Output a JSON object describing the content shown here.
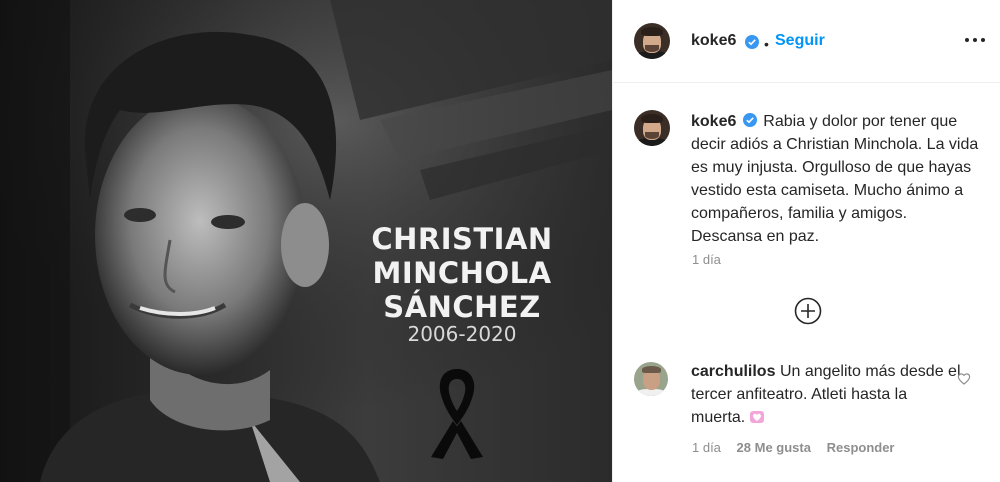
{
  "post": {
    "photo": {
      "name_line1": "CHRISTIAN",
      "name_line2": "MINCHOLA",
      "name_line3": "SÁNCHEZ",
      "years": "2006-2020",
      "ribbon_icon": "black-mourning-ribbon-icon"
    },
    "header": {
      "username": "koke6",
      "verified_icon": "verified-badge-icon",
      "separator": "•",
      "follow_label": "Seguir",
      "more_icon": "more-options-icon"
    },
    "caption": {
      "username": "koke6",
      "text": "Rabia y dolor por tener que decir adiós a Christian Minchola. La vida es muy injusta. Orgulloso de que hayas vestido esta camiseta. Mucho ánimo a compañeros, familia y amigos. Descansa en paz.",
      "time": "1 día"
    },
    "load_more_icon": "plus-circle-icon",
    "comments": [
      {
        "username": "carchulilos",
        "text": "Un angelito más desde el tercer anfiteatro. Atleti hasta la muerta.",
        "emoji": "pink-heart-emoji",
        "time": "1 día",
        "likes": "28 Me gusta",
        "reply_label": "Responder",
        "like_icon": "heart-outline-icon"
      }
    ]
  },
  "colors": {
    "accent": "#0095f6",
    "verified": "#3897f0",
    "muted": "#8e8e8e",
    "text": "#262626"
  }
}
